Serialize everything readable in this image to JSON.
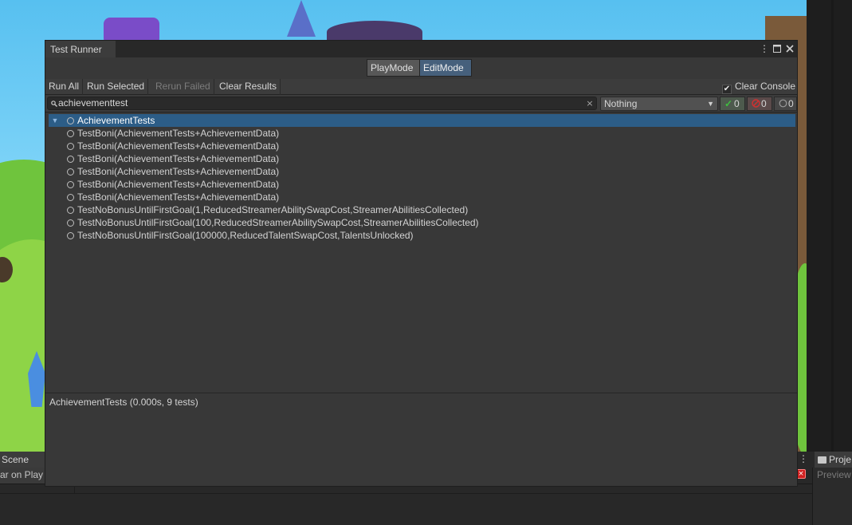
{
  "window": {
    "title": "Test Runner"
  },
  "modes": [
    {
      "label": "PlayMode",
      "active": false
    },
    {
      "label": "EditMode",
      "active": true
    }
  ],
  "toolbar": {
    "run_all": "Run All",
    "run_selected": "Run Selected",
    "rerun_failed": "Rerun Failed",
    "clear_results": "Clear Results",
    "clear_console": "Clear Console",
    "clear_console_checked": true
  },
  "filter": {
    "search_value": "achievementtest",
    "category": "Nothing",
    "passed_count": "0",
    "failed_count": "0",
    "skipped_count": "0"
  },
  "tree": {
    "root": "AchievementTests",
    "items": [
      "TestBoni(AchievementTests+AchievementData)",
      "TestBoni(AchievementTests+AchievementData)",
      "TestBoni(AchievementTests+AchievementData)",
      "TestBoni(AchievementTests+AchievementData)",
      "TestBoni(AchievementTests+AchievementData)",
      "TestBoni(AchievementTests+AchievementData)",
      "TestNoBonusUntilFirstGoal(1,ReducedStreamerAbilitySwapCost,StreamerAbilitiesCollected)",
      "TestNoBonusUntilFirstGoal(100,ReducedStreamerAbilitySwapCost,StreamerAbilitiesCollected)",
      "TestNoBonusUntilFirstGoal(100000,ReducedTalentSwapCost,TalentsUnlocked)"
    ]
  },
  "status": "AchievementTests (0.000s, 9 tests)",
  "editor": {
    "scene_tab": "Scene",
    "scene_bar_text": "ar on Play",
    "project_tab": "Proje",
    "preview_label": "Preview"
  },
  "colors": {
    "selection": "#2c5d87",
    "active_mode": "#46607c",
    "passed": "#3fbf3f",
    "failed": "#d23030"
  },
  "icons": {
    "passed": "checkmark-icon",
    "failed": "failed-icon",
    "skipped": "not-run-icon"
  }
}
